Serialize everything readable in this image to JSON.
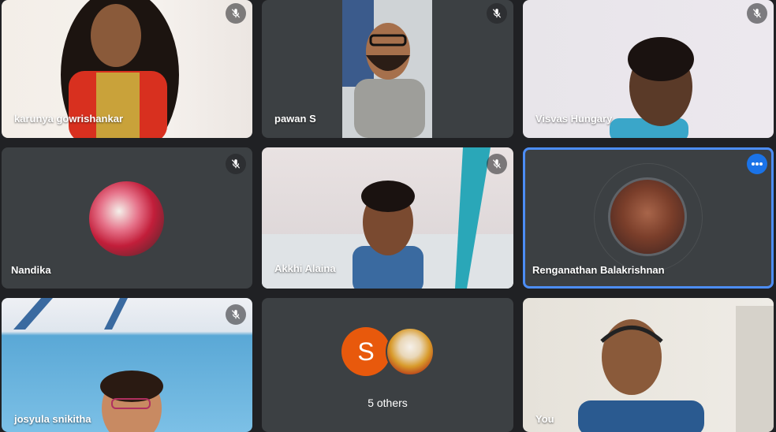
{
  "participants": [
    {
      "name": "karunya gowrishankar",
      "muted": true
    },
    {
      "name": "pawan S",
      "muted": true
    },
    {
      "name": "Visvas Hungary",
      "muted": true
    },
    {
      "name": "Nandika",
      "muted": true
    },
    {
      "name": "Akkhi Alaina",
      "muted": true
    },
    {
      "name": "Renganathan Balakrishnan",
      "muted": false,
      "active_speaker": true
    },
    {
      "name": "josyula snikitha",
      "muted": true
    },
    {
      "name": "You",
      "muted": false
    }
  ],
  "others": {
    "avatar_letter": "S",
    "count_label": "5 others"
  },
  "icons": {
    "mic_off": "mic-off-icon",
    "more": "more-options-icon"
  },
  "colors": {
    "tile_bg": "#3c4043",
    "page_bg": "#202124",
    "active_border": "#4c8df6",
    "avatar_s": "#e8590c"
  }
}
